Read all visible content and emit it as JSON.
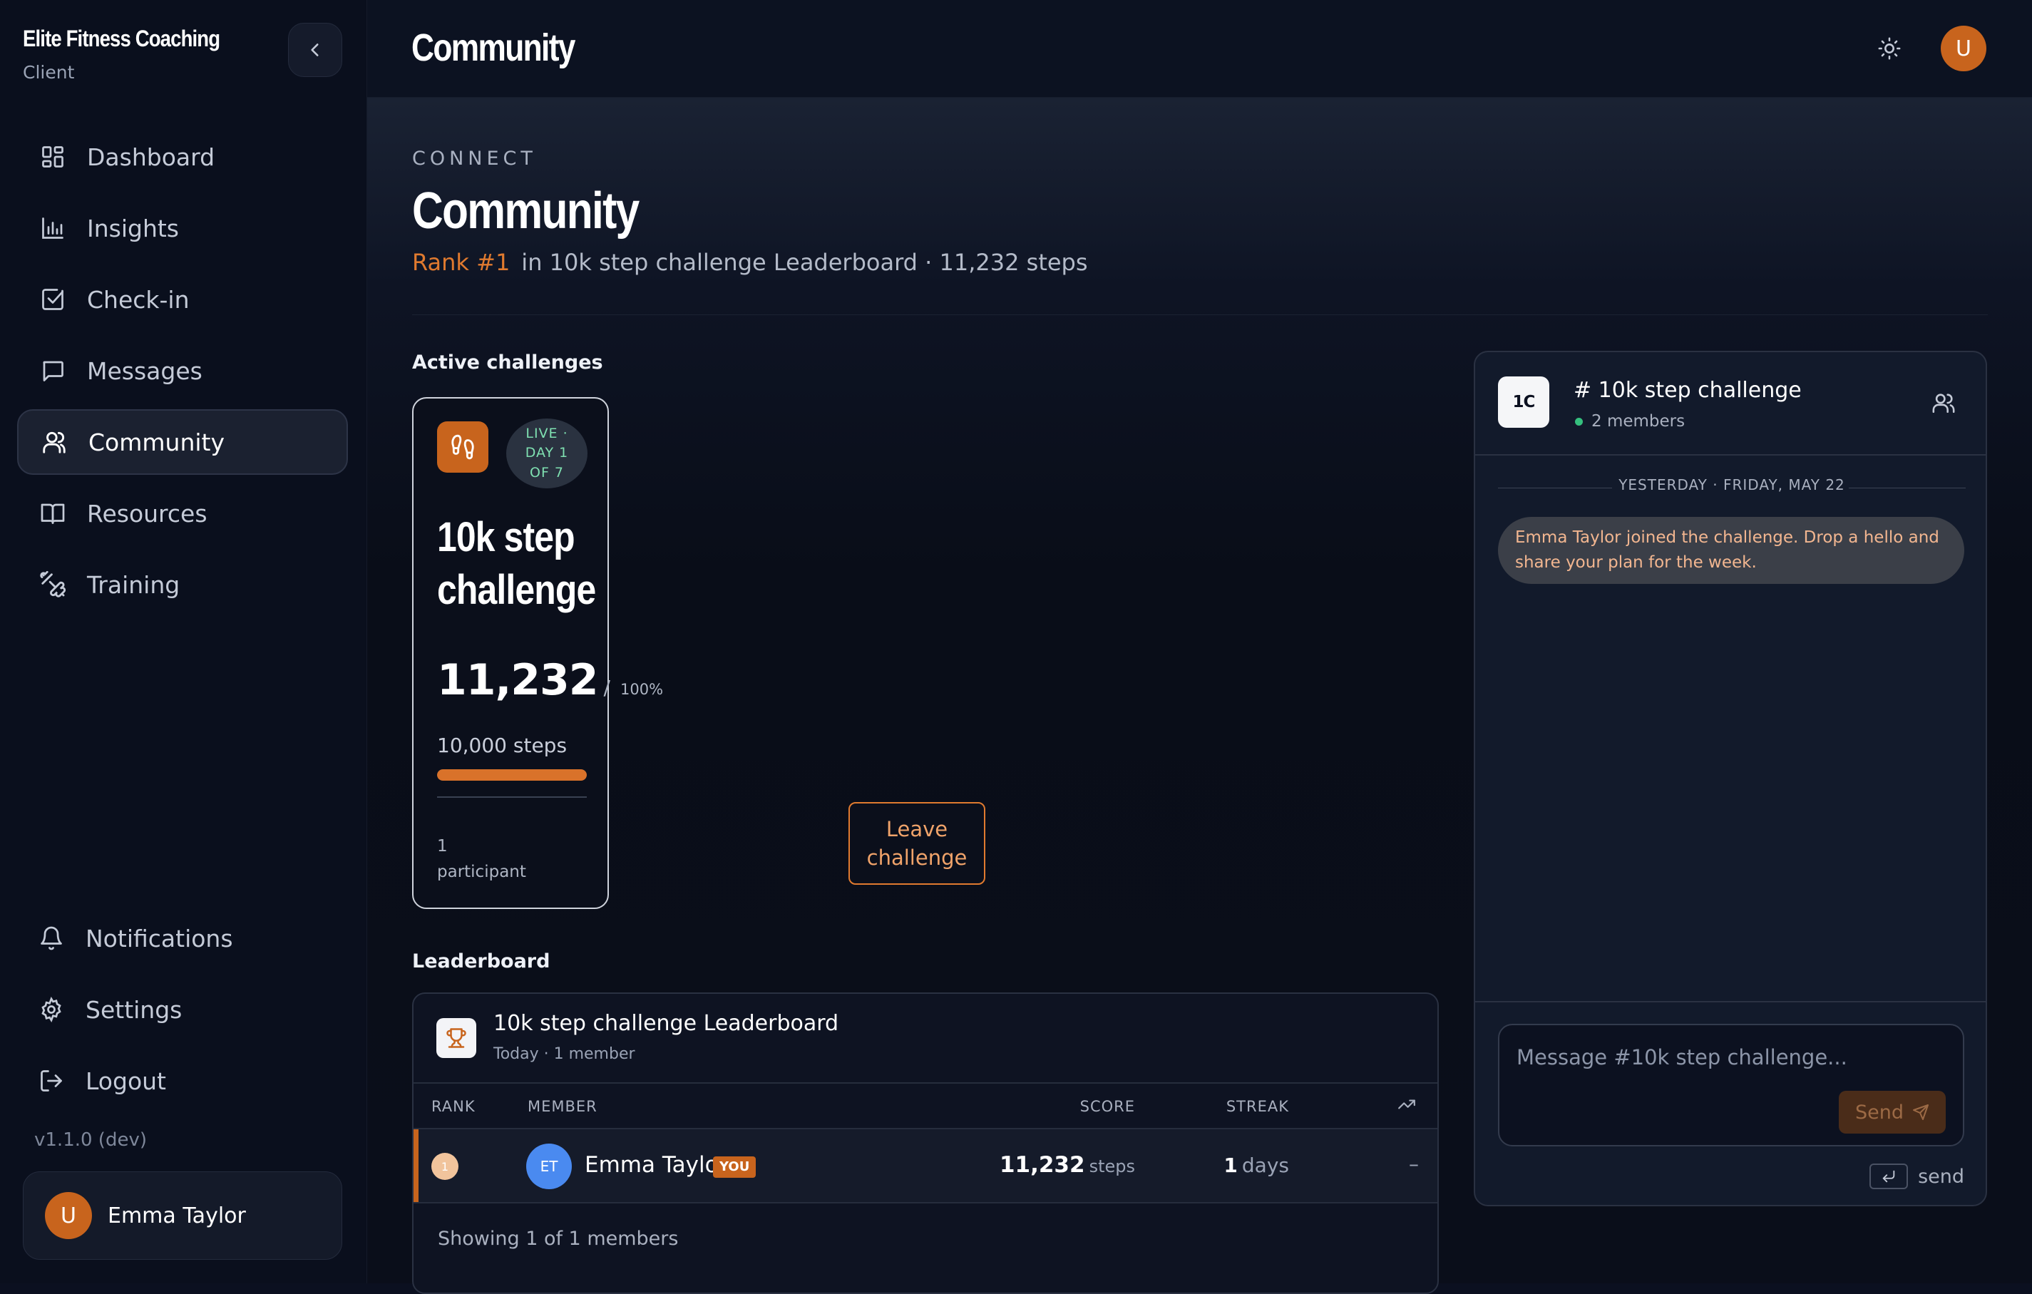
{
  "brand": {
    "title": "Elite Fitness Coaching",
    "subtitle": "Client"
  },
  "nav": {
    "items": [
      {
        "label": "Dashboard",
        "icon": "dashboard-icon"
      },
      {
        "label": "Insights",
        "icon": "bar-chart-icon"
      },
      {
        "label": "Check-in",
        "icon": "checkbox-icon"
      },
      {
        "label": "Messages",
        "icon": "message-icon"
      },
      {
        "label": "Community",
        "icon": "users-icon",
        "active": true
      },
      {
        "label": "Resources",
        "icon": "book-icon"
      },
      {
        "label": "Training",
        "icon": "dumbbell-icon"
      }
    ],
    "bottom": [
      {
        "label": "Notifications",
        "icon": "bell-icon"
      },
      {
        "label": "Settings",
        "icon": "gear-icon"
      },
      {
        "label": "Logout",
        "icon": "logout-icon"
      }
    ],
    "version": "v1.1.0 (dev)"
  },
  "user": {
    "initial": "U",
    "name": "Emma Taylor"
  },
  "topbar": {
    "title": "Community"
  },
  "page": {
    "eyebrow": "CONNECT",
    "title": "Community",
    "rank_highlight": "Rank #1",
    "rank_text": "in 10k step challenge Leaderboard · 11,232 steps"
  },
  "challenges": {
    "section_label": "Active challenges",
    "card": {
      "live_line1": "LIVE ·",
      "live_line2": "DAY 1",
      "live_line3": "OF 7",
      "title": "10k step challenge",
      "score": "11,232",
      "separator": "/",
      "percent_text": "100%",
      "progress": 1.0,
      "target": "10,000 steps",
      "participants_count": "1",
      "participants_label": "participant",
      "leave_label": "Leave challenge"
    }
  },
  "leaderboard": {
    "section_label": "Leaderboard",
    "title": "10k step challenge Leaderboard",
    "subtitle": "Today · 1 member",
    "columns": {
      "rank": "RANK",
      "member": "MEMBER",
      "score": "SCORE",
      "streak": "STREAK"
    },
    "rows": [
      {
        "rank": "1",
        "initials": "ET",
        "name": "Emma Taylor",
        "badge": "YOU",
        "score": "11,232",
        "score_unit": "steps",
        "streak": "1",
        "streak_unit": "days",
        "trend": "–"
      }
    ],
    "footer": "Showing 1 of 1 members"
  },
  "chat": {
    "logo": "1C",
    "channel_name": "# 10k step challenge",
    "members": "2 members",
    "day_separator": "YESTERDAY · FRIDAY, MAY 22",
    "system_message": "Emma Taylor joined the challenge. Drop a hello and share your plan for the week.",
    "input_placeholder": "Message #10k step challenge...",
    "send_label": "Send",
    "hint_label": "send"
  },
  "colors": {
    "accent": "#c8641d",
    "background": "#0b1020",
    "live": "#7fe0b1"
  }
}
